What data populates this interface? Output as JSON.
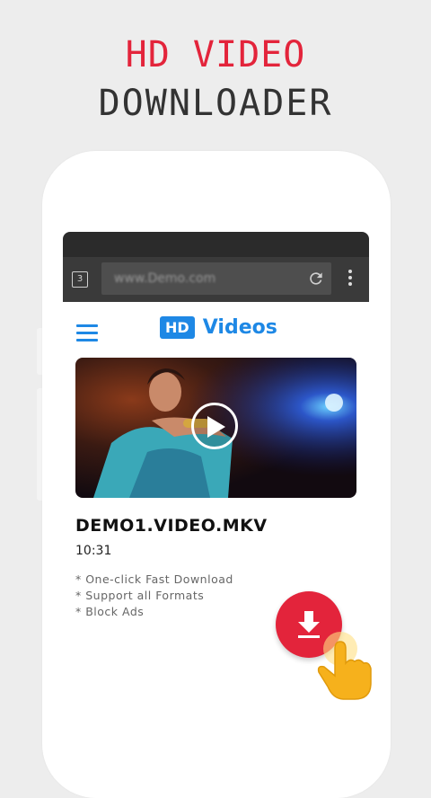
{
  "headline": {
    "line1": "HD VIDEO",
    "line2": "DOWNLOADER"
  },
  "browser": {
    "tab_count": "3",
    "url": "www.Demo.com",
    "icons": [
      "tabs-icon",
      "reload-icon",
      "more-vert-icon"
    ]
  },
  "app": {
    "logo_badge": "HD",
    "logo_text": "Videos",
    "menu_icon": "hamburger-menu-icon"
  },
  "video": {
    "title": "DEMO1.VIDEO.MKV",
    "duration": "10:31"
  },
  "features": [
    "* One-click Fast Download",
    "* Support all Formats",
    "* Block Ads"
  ],
  "colors": {
    "accent_red": "#e3243b",
    "brand_blue": "#1e88e5",
    "browser_dark": "#3a3a3a"
  }
}
